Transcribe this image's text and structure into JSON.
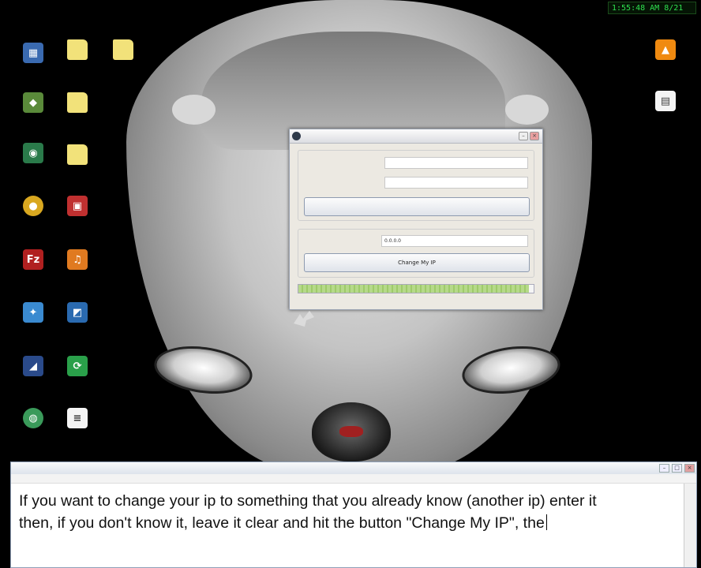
{
  "clock": "1:55:48 AM 8/21",
  "app": {
    "title": "",
    "group_ip_label": "",
    "enter_ip_label": "",
    "wait_label": "",
    "hide_button": "",
    "group_ip2_label": "",
    "change_to_label": "",
    "change_to_value": "0.0.0.0",
    "change_button": "Change My IP",
    "status": "",
    "progress": 0.98
  },
  "notepad": {
    "title": "",
    "menu": [
      "",
      "",
      "",
      "",
      ""
    ],
    "lines": [
      "If you want to change your ip to something that you already know (another ip) enter it",
      "then, if you don't know it, leave it clear and hit the button \"Change My IP\", the"
    ]
  },
  "icons": {
    "folder": "folder-icon",
    "vlc": "vlc-icon",
    "document": "document-icon",
    "filezilla": "filezilla-icon",
    "globe": "globe-icon"
  }
}
